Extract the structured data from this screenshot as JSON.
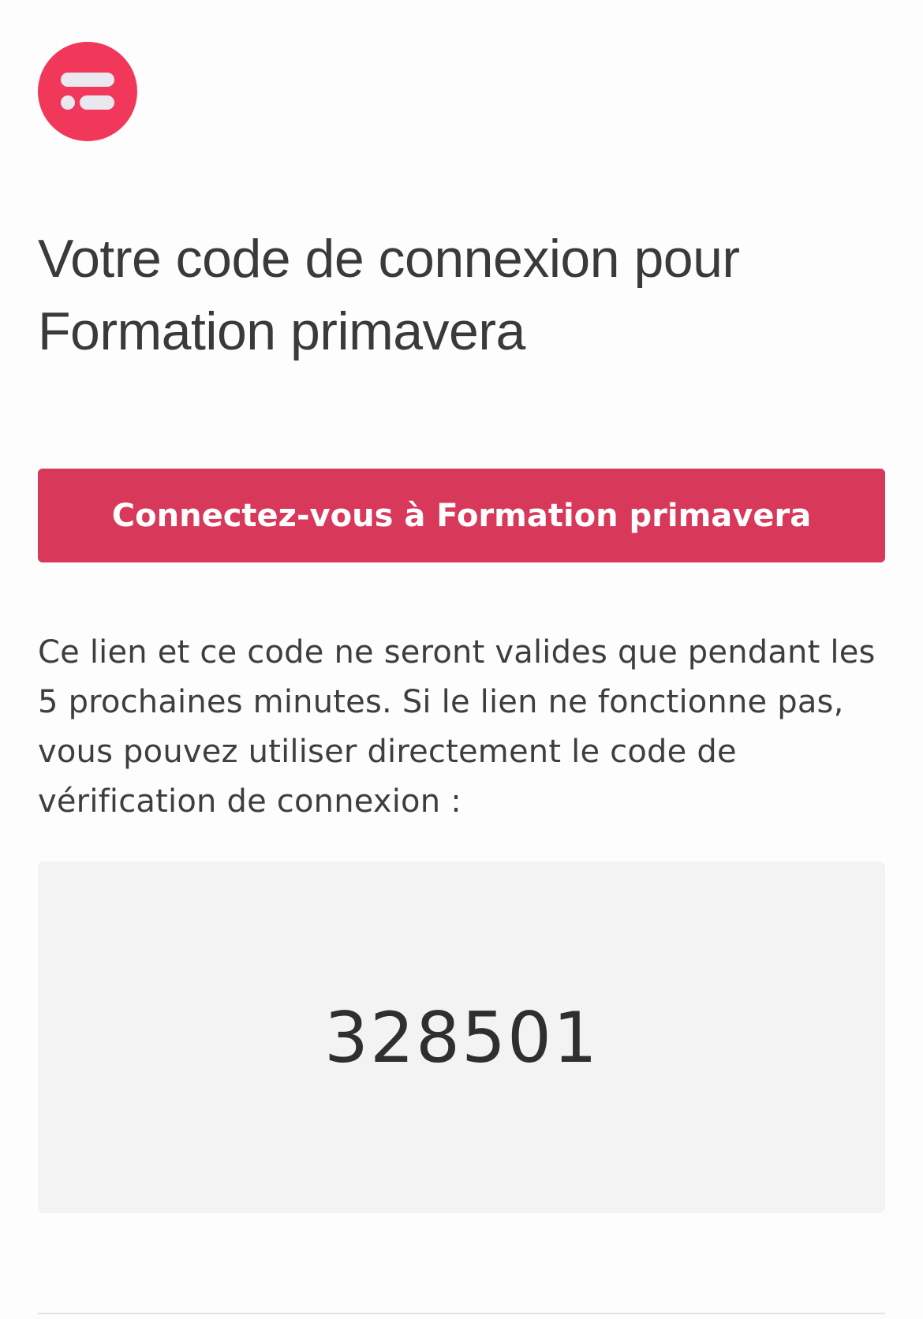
{
  "logo": {
    "icon": "brand-logo-icon",
    "color": "#f2385a"
  },
  "heading": {
    "title": "Votre code de connexion pour Formation primavera"
  },
  "login_button": {
    "label": "Connectez-vous à Formation primavera",
    "color": "#d8385a"
  },
  "info_text": "Ce lien et ce code ne seront valides que pendant les 5 prochaines minutes. Si le lien ne fonctionne pas, vous pouvez utiliser directement le code de vérification de connexion :",
  "verification": {
    "code": "328501"
  }
}
